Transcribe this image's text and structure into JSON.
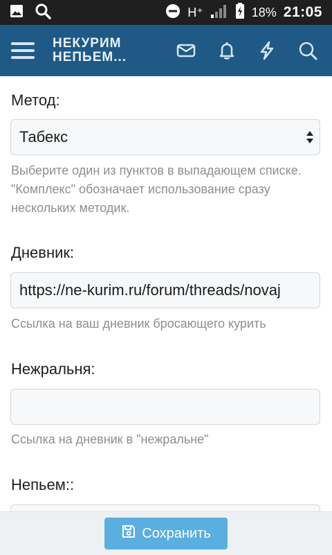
{
  "status_bar": {
    "network": "H⁺",
    "battery": "18%",
    "time": "21:05",
    "icons": [
      "image-icon",
      "search-icon",
      "dnd-icon",
      "signal-icon",
      "battery-charging-icon"
    ]
  },
  "header": {
    "logo_line1": "НЕКУРИМ",
    "logo_line2": "НЕПЬЕМ...",
    "icons": [
      "menu-icon",
      "mail-icon",
      "bell-icon",
      "bolt-icon",
      "search-icon"
    ]
  },
  "form": {
    "method": {
      "label": "Метод:",
      "value": "Табекс",
      "hint": "Выберите один из пунктов в выпадающем списке. \"Комплекс\" обозначает использование сразу нескольких методик."
    },
    "diary": {
      "label": "Дневник:",
      "value": "https://ne-kurim.ru/forum/threads/novaj",
      "hint": "Ссылка на ваш дневник бросающего курить"
    },
    "nezhralnya": {
      "label": "Нежральня:",
      "value": "",
      "hint": "Ссылка на дневник в \"нежральне\""
    },
    "nepyem": {
      "label": "Непьем::"
    }
  },
  "actions": {
    "save_label": "Сохранить"
  },
  "colors": {
    "header": "#1f5a86",
    "status_bar": "#1f1f1f",
    "button": "#5aaee0"
  }
}
